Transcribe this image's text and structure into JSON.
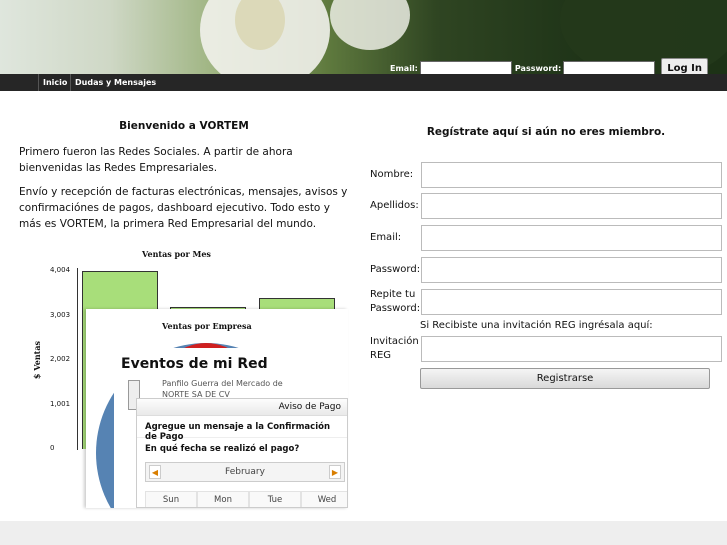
{
  "header": {
    "email_label": "Email:",
    "password_label": "Password:",
    "login_button": "Log In"
  },
  "nav": {
    "items": [
      "Inicio",
      "Dudas y Mensajes"
    ]
  },
  "welcome": {
    "title": "Bienvenido a VORTEM",
    "p1": "Primero fueron las Redes Sociales. A partir de ahora bienvenidas las Redes Empresariales.",
    "p2": "Envío y recepción de facturas electrónicas, mensajes, avisos y confirmaciónes de pagos, dashboard ejecutivo. Todo esto y más es VORTEM, la primera Red Empresarial del mundo."
  },
  "chart_data": {
    "type": "bar",
    "title": "Ventas por Mes",
    "ylabel": "$ Ventas",
    "yticks": [
      "4,004",
      "3,003",
      "2,002",
      "1,001",
      "0"
    ],
    "ylim": [
      0,
      4004
    ],
    "values": [
      4004,
      3200,
      3400
    ]
  },
  "overlays": {
    "chart2_title": "Ventas por Empresa",
    "events_title": "Eventos de mi Red",
    "event_item": "Panfilo Guerra del Mercado de NORTE SA DE CV",
    "payment_header": "Aviso de Pago",
    "payment_line": "Agregue un mensaje a la Confirmación de Pago",
    "date_question": "En qué fecha se realizó el pago?",
    "month": "February",
    "days": [
      "Sun",
      "Mon",
      "Tue",
      "Wed"
    ]
  },
  "register": {
    "title": "Regístrate aquí si aún no eres miembro.",
    "fields": [
      "Nombre:",
      "Apellidos:",
      "Email:",
      "Password:",
      "Repite tu Password:"
    ],
    "invite_hint": "Si Recibiste una invitación REG ingrésala aquí:",
    "invite_label": "Invitación REG",
    "button": "Registrarse"
  }
}
